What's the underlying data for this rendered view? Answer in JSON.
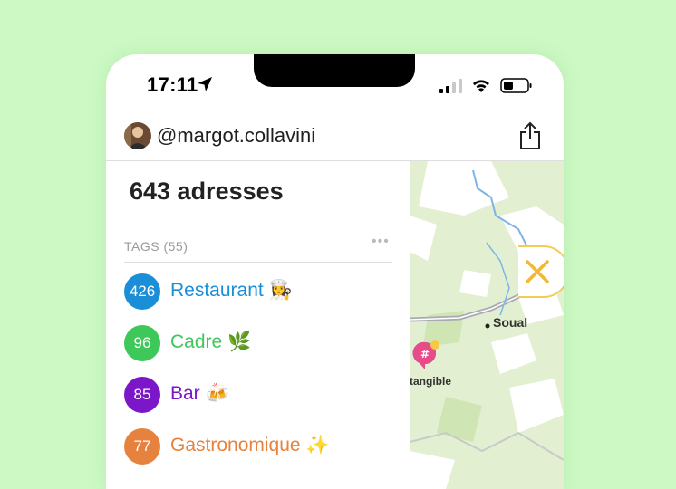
{
  "status": {
    "time": "17:11"
  },
  "header": {
    "username": "@margot.collavini"
  },
  "panel": {
    "count": "643 adresses",
    "tags_label": "TAGS (55)",
    "more": "•••"
  },
  "tags": [
    {
      "count": "426",
      "label": "Restaurant 👩‍🍳",
      "color": "#1a8fd8"
    },
    {
      "count": "96",
      "label": "Cadre 🌿",
      "color": "#3ec85a"
    },
    {
      "count": "85",
      "label": "Bar 🍻",
      "color": "#7b16c9"
    },
    {
      "count": "77",
      "label": "Gastronomique ✨",
      "color": "#e7823e"
    }
  ],
  "map": {
    "place": "Soual",
    "pin_label": "tangible"
  },
  "colors": {
    "background": "#cdf9c4",
    "accent_close": "#f2b733"
  }
}
